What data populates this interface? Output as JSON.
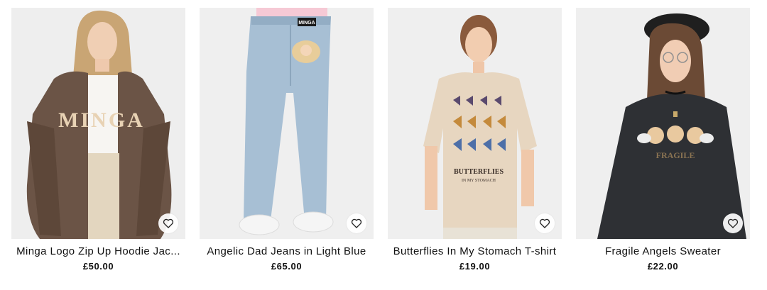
{
  "products": [
    {
      "name": "Minga Logo Zip Up Hoodie Jac...",
      "price": "£50.00",
      "print_text": "MINGA",
      "garment_color": "#6b5446",
      "icon": "heart-outline-icon"
    },
    {
      "name": "Angelic Dad Jeans in Light Blue",
      "price": "£65.00",
      "tag_text": "MINGA",
      "garment_color": "#a7bfd4",
      "icon": "heart-outline-icon"
    },
    {
      "name": "Butterflies In My Stomach T-shirt",
      "price": "£19.00",
      "print_text": "BUTTERFLIES",
      "print_subtext": "IN MY STOMACH",
      "garment_color": "#e7d6c0",
      "icon": "heart-outline-icon"
    },
    {
      "name": "Fragile Angels Sweater",
      "price": "£22.00",
      "print_text": "FRAGILE",
      "garment_color": "#2e3034",
      "icon": "heart-outline-icon"
    }
  ]
}
